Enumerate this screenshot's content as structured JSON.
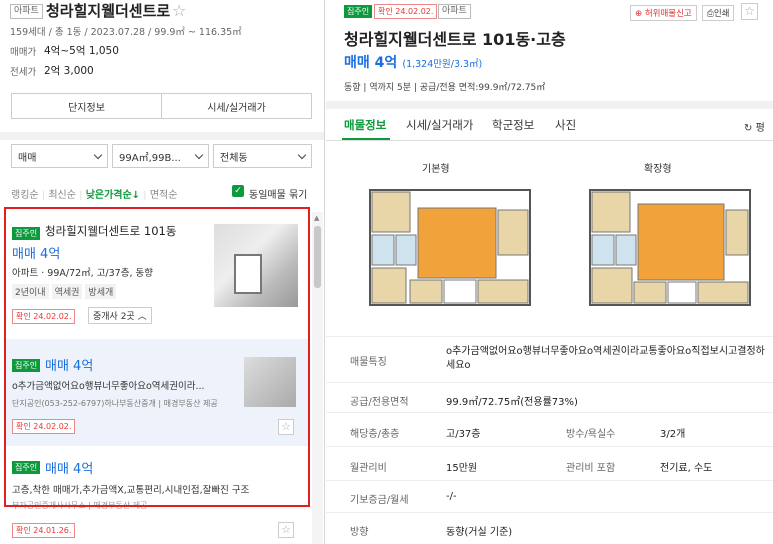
{
  "left": {
    "type_badge": "아파트",
    "complex_name": "청라힐지웰더센트로",
    "complex_info": "159세대 / 총 1동 / 2023.07.28 / 99.9㎡ ~ 116.35㎡",
    "sale_label": "매매가",
    "sale_value": "4억~5억 1,050",
    "rent_label": "전세가",
    "rent_value": "2억 3,000",
    "buttons": {
      "complex": "단지정보",
      "price": "시세/실거래가"
    },
    "filters": {
      "type": "매매",
      "area": "99A㎡,99B...",
      "dong": "전체동"
    },
    "sort": {
      "items": [
        "랭킹순",
        "최신순",
        "낮은가격순↓",
        "면적순"
      ],
      "active": "낮은가격순↓",
      "same_label": "동일매물 묶기"
    },
    "listings": [
      {
        "owner": "집주인",
        "title": "청라힐지웰더센트로 101동",
        "price": "매매 4억",
        "spec": "아파트 · 99A/72㎡, 고/37층, 동향",
        "tags": [
          "2년이내",
          "역세권",
          "방세개"
        ],
        "confirm": "확인 24.02.02.",
        "agents": "중개사 2곳"
      },
      {
        "owner": "집주인",
        "price": "매매 4억",
        "desc": "o추가금액없어요o행뷰너무좋아요o역세권이라...",
        "agent": "단지공인(053-252-6797)하나부동산중개",
        "provider": "매경부동산 제공",
        "confirm": "확인 24.02.02."
      },
      {
        "owner": "집주인",
        "price": "매매 4억",
        "desc": "고층,착한 매매가,추가금액X,교통편리,시내인접,잘빠진 구조",
        "agent": "부자공인중개사사무소",
        "provider": "매경부동산 제공",
        "confirm": "확인 24.01.26."
      }
    ],
    "photo_caption": "매경부동산 제공"
  },
  "right": {
    "owner_badge": "집주인",
    "confirm_badge": "확인 24.02.02.",
    "type_badge": "아파트",
    "report": "허위매물신고",
    "print": "인쇄",
    "title": "청라힐지웰더센트로 101동·고층",
    "price": "매매 4억",
    "price_per": "(1,324만원/3.3㎡)",
    "summary": "동향 | 역까지 5분 | 공급/전용 면적:99.9㎡/72.75㎡",
    "tabs": [
      "매물정보",
      "시세/실거래가",
      "학군정보",
      "사진"
    ],
    "tab_active": "매물정보",
    "tab_extra": "평",
    "plan_labels": [
      "기본형",
      "확장형"
    ],
    "rows": [
      {
        "k": "매물특징",
        "v": "o추가금액없어요o행뷰너무좋아요o역세권이라교통좋아요o직접보시고결정하세요o"
      },
      {
        "k": "공급/전용면적",
        "v": "99.9㎡/72.75㎡(전용률73%)"
      },
      {
        "k": "해당층/총층",
        "v": "고/37층",
        "k2": "방수/욕실수",
        "v2": "3/2개"
      },
      {
        "k": "월관리비",
        "v": "15만원",
        "k2": "관리비 포함",
        "v2": "전기료, 수도"
      },
      {
        "k": "기보증금/월세",
        "v": "-/-"
      },
      {
        "k": "방향",
        "v": "동향(거실 기준)"
      }
    ]
  }
}
